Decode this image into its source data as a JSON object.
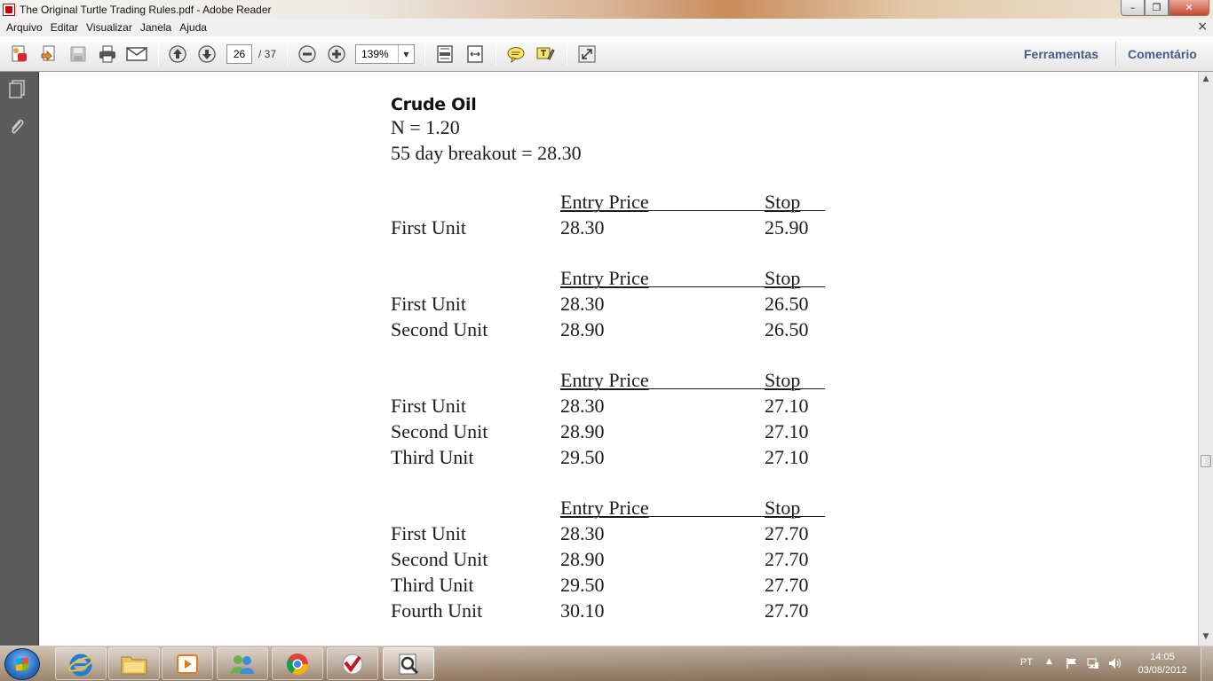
{
  "window": {
    "title": "The Original Turtle Trading Rules.pdf - Adobe Reader",
    "min_glyph": "–",
    "max_glyph": "❐",
    "close_glyph": "✕"
  },
  "menu": {
    "items": [
      "Arquivo",
      "Editar",
      "Visualizar",
      "Janela",
      "Ajuda"
    ],
    "close_glyph": "×"
  },
  "toolbar": {
    "page_current": "26",
    "page_total": "/ 37",
    "zoom": "139%",
    "zoom_arrow": "▼",
    "tools_label": "Ferramentas",
    "comment_label": "Comentário"
  },
  "document": {
    "heading": "Crude Oil",
    "lines": [
      "N = 1.20",
      "55 day breakout = 28.30"
    ],
    "header": {
      "entry": "Entry Price",
      "stop": "Stop"
    },
    "tables": [
      {
        "rows": [
          {
            "unit": "First Unit",
            "entry": "28.30",
            "stop": "25.90"
          }
        ]
      },
      {
        "rows": [
          {
            "unit": "First Unit",
            "entry": "28.30",
            "stop": "26.50"
          },
          {
            "unit": "Second Unit",
            "entry": "28.90",
            "stop": "26.50"
          }
        ]
      },
      {
        "rows": [
          {
            "unit": "First Unit",
            "entry": "28.30",
            "stop": "27.10"
          },
          {
            "unit": "Second Unit",
            "entry": "28.90",
            "stop": "27.10"
          },
          {
            "unit": "Third Unit",
            "entry": "29.50",
            "stop": "27.10"
          }
        ]
      },
      {
        "rows": [
          {
            "unit": "First Unit",
            "entry": "28.30",
            "stop": "27.70"
          },
          {
            "unit": "Second Unit",
            "entry": "28.90",
            "stop": "27.70"
          },
          {
            "unit": "Third Unit",
            "entry": "29.50",
            "stop": "27.70"
          },
          {
            "unit": "Fourth Unit",
            "entry": "30.10",
            "stop": "27.70"
          }
        ]
      }
    ]
  },
  "scrollbar": {
    "up_glyph": "▲",
    "down_glyph": "▼"
  },
  "taskbar": {
    "language": "PT",
    "time": "14:05",
    "date": "03/08/2012"
  }
}
